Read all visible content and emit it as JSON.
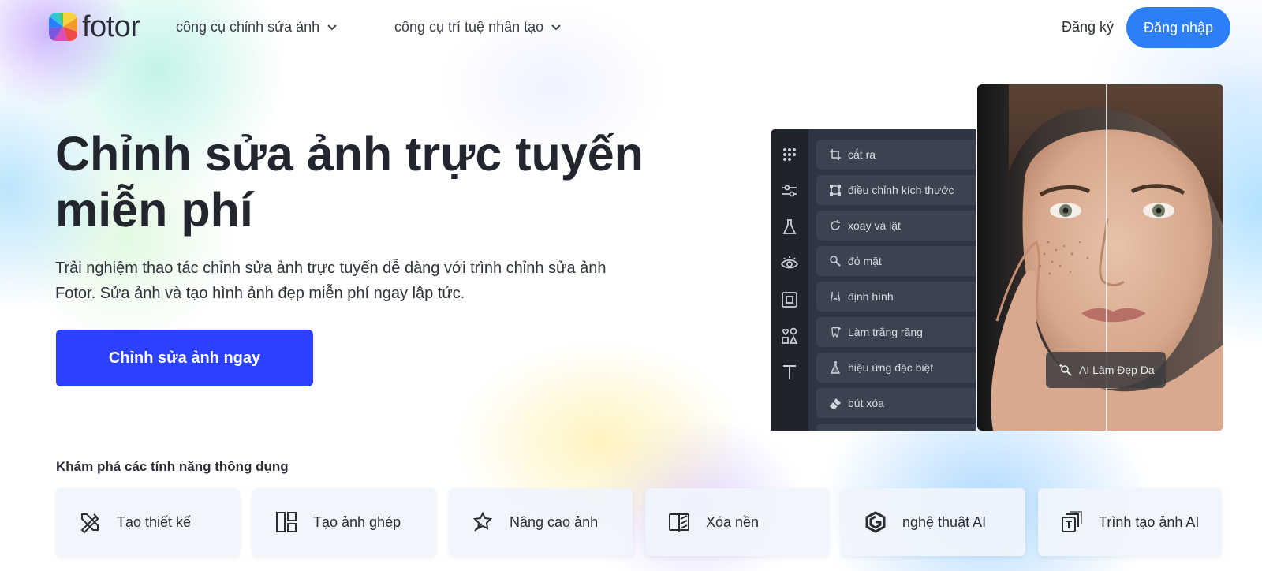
{
  "header": {
    "logo_text": "fotor",
    "nav": [
      {
        "label": "công cụ chỉnh sửa ảnh",
        "icon": "chevron-down-icon"
      },
      {
        "label": "công cụ trí tuệ nhân tạo",
        "icon": "chevron-down-icon"
      }
    ],
    "signup_label": "Đăng ký",
    "login_label": "Đăng nhập"
  },
  "hero": {
    "title": "Chỉnh sửa ảnh trực tuyến miễn phí",
    "description": "Trải nghiệm thao tác chỉnh sửa ảnh trực tuyến dễ dàng với trình chỉnh sửa ảnh Fotor. Sửa ảnh và tạo hình ảnh đẹp miễn phí ngay lập tức.",
    "cta_label": "Chỉnh sửa ảnh ngay"
  },
  "editor": {
    "rail_icons": [
      "grid-icon",
      "sliders-icon",
      "flask-icon",
      "eye-icon",
      "frame-icon",
      "shapes-icon",
      "text-icon"
    ],
    "tools": [
      {
        "label": "cắt ra",
        "icon": "crop-icon"
      },
      {
        "label": "điều chỉnh kích thước",
        "icon": "resize-icon"
      },
      {
        "label": "xoay và lật",
        "icon": "rotate-icon"
      },
      {
        "label": "đỏ mặt",
        "icon": "blush-icon"
      },
      {
        "label": "định hình",
        "icon": "reshape-icon"
      },
      {
        "label": "Làm trắng răng",
        "icon": "teeth-whitening-icon"
      },
      {
        "label": "hiệu ứng đặc biệt",
        "icon": "effects-icon"
      },
      {
        "label": "bút xóa",
        "icon": "eraser-icon"
      }
    ],
    "badge_label": "AI Làm Đẹp Da"
  },
  "features": {
    "heading": "Khám phá các tính năng thông dụng",
    "items": [
      {
        "label": "Tạo thiết kế",
        "icon": "design-tools-icon"
      },
      {
        "label": "Tạo ảnh ghép",
        "icon": "collage-icon"
      },
      {
        "label": "Nâng cao ảnh",
        "icon": "enhance-icon"
      },
      {
        "label": "Xóa nền",
        "icon": "remove-background-icon"
      },
      {
        "label": "nghệ thuật AI",
        "icon": "ai-art-icon"
      },
      {
        "label": "Trình tạo ảnh AI",
        "icon": "ai-image-generator-icon"
      }
    ]
  },
  "colors": {
    "login_bg": "#2d7ff9",
    "cta_bg": "#2b41ff",
    "editor_panel": "#2f3542"
  }
}
